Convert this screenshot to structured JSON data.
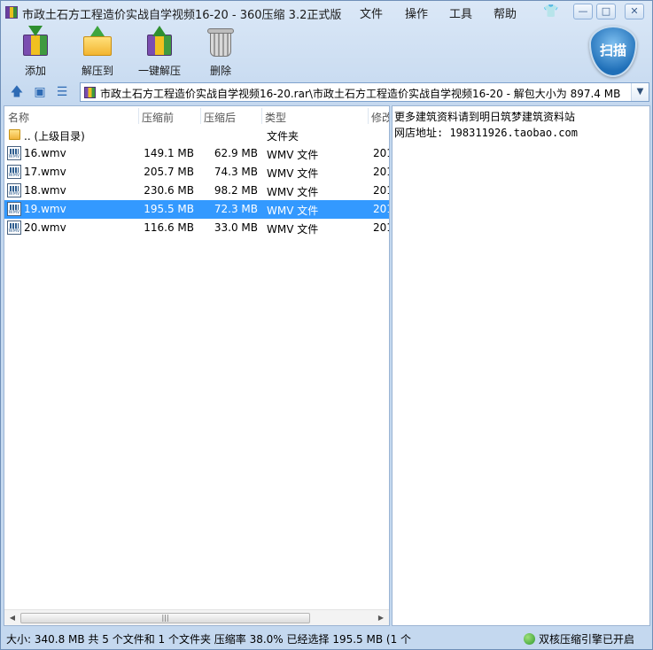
{
  "window": {
    "title": "市政土石方工程造价实战自学视频16-20 - 360压缩 3.2正式版"
  },
  "menu": [
    "文件",
    "操作",
    "工具",
    "帮助"
  ],
  "window_buttons": {
    "minimize": "—",
    "maximize": "□",
    "close": "✕"
  },
  "toolbar": {
    "add": "添加",
    "extract": "解压到",
    "one_click_extract": "一键解压",
    "delete": "删除",
    "scan": "扫描"
  },
  "address": {
    "path": "市政土石方工程造价实战自学视频16-20.rar\\市政土石方工程造价实战自学视频16-20 - 解包大小为 897.4 MB",
    "dropdown": "▼"
  },
  "columns": {
    "name": "名称",
    "packed": "压缩前",
    "unpacked": "压缩后",
    "type": "类型",
    "modified": "修改"
  },
  "files": [
    {
      "name": ".. (上级目录)",
      "packed": "",
      "unpacked": "",
      "type": "文件夹",
      "date": "",
      "icon": "folder-icon",
      "selected": false
    },
    {
      "name": "16.wmv",
      "packed": "149.1 MB",
      "unpacked": "62.9 MB",
      "type": "WMV 文件",
      "date": "201",
      "icon": "wmv-file-icon",
      "selected": false
    },
    {
      "name": "17.wmv",
      "packed": "205.7 MB",
      "unpacked": "74.3 MB",
      "type": "WMV 文件",
      "date": "201",
      "icon": "wmv-file-icon",
      "selected": false
    },
    {
      "name": "18.wmv",
      "packed": "230.6 MB",
      "unpacked": "98.2 MB",
      "type": "WMV 文件",
      "date": "201",
      "icon": "wmv-file-icon",
      "selected": false
    },
    {
      "name": "19.wmv",
      "packed": "195.5 MB",
      "unpacked": "72.3 MB",
      "type": "WMV 文件",
      "date": "201",
      "icon": "wmv-file-icon",
      "selected": true
    },
    {
      "name": "20.wmv",
      "packed": "116.6 MB",
      "unpacked": "33.0 MB",
      "type": "WMV 文件",
      "date": "201",
      "icon": "wmv-file-icon",
      "selected": false
    }
  ],
  "comment": {
    "line1": "更多建筑资料请到明日筑梦建筑资料站",
    "line2": "网店地址: 198311926.taobao.com"
  },
  "scrollbar": {
    "left": "◀",
    "right": "▶",
    "grip": "|||"
  },
  "status": {
    "info": "大小: 340.8 MB 共 5 个文件和 1 个文件夹 压缩率 38.0% 已经选择 195.5 MB (1 个",
    "engine": "双核压缩引擎已开启"
  },
  "colors": {
    "selection": "#3399ff",
    "accent": "#2e6bb5"
  }
}
